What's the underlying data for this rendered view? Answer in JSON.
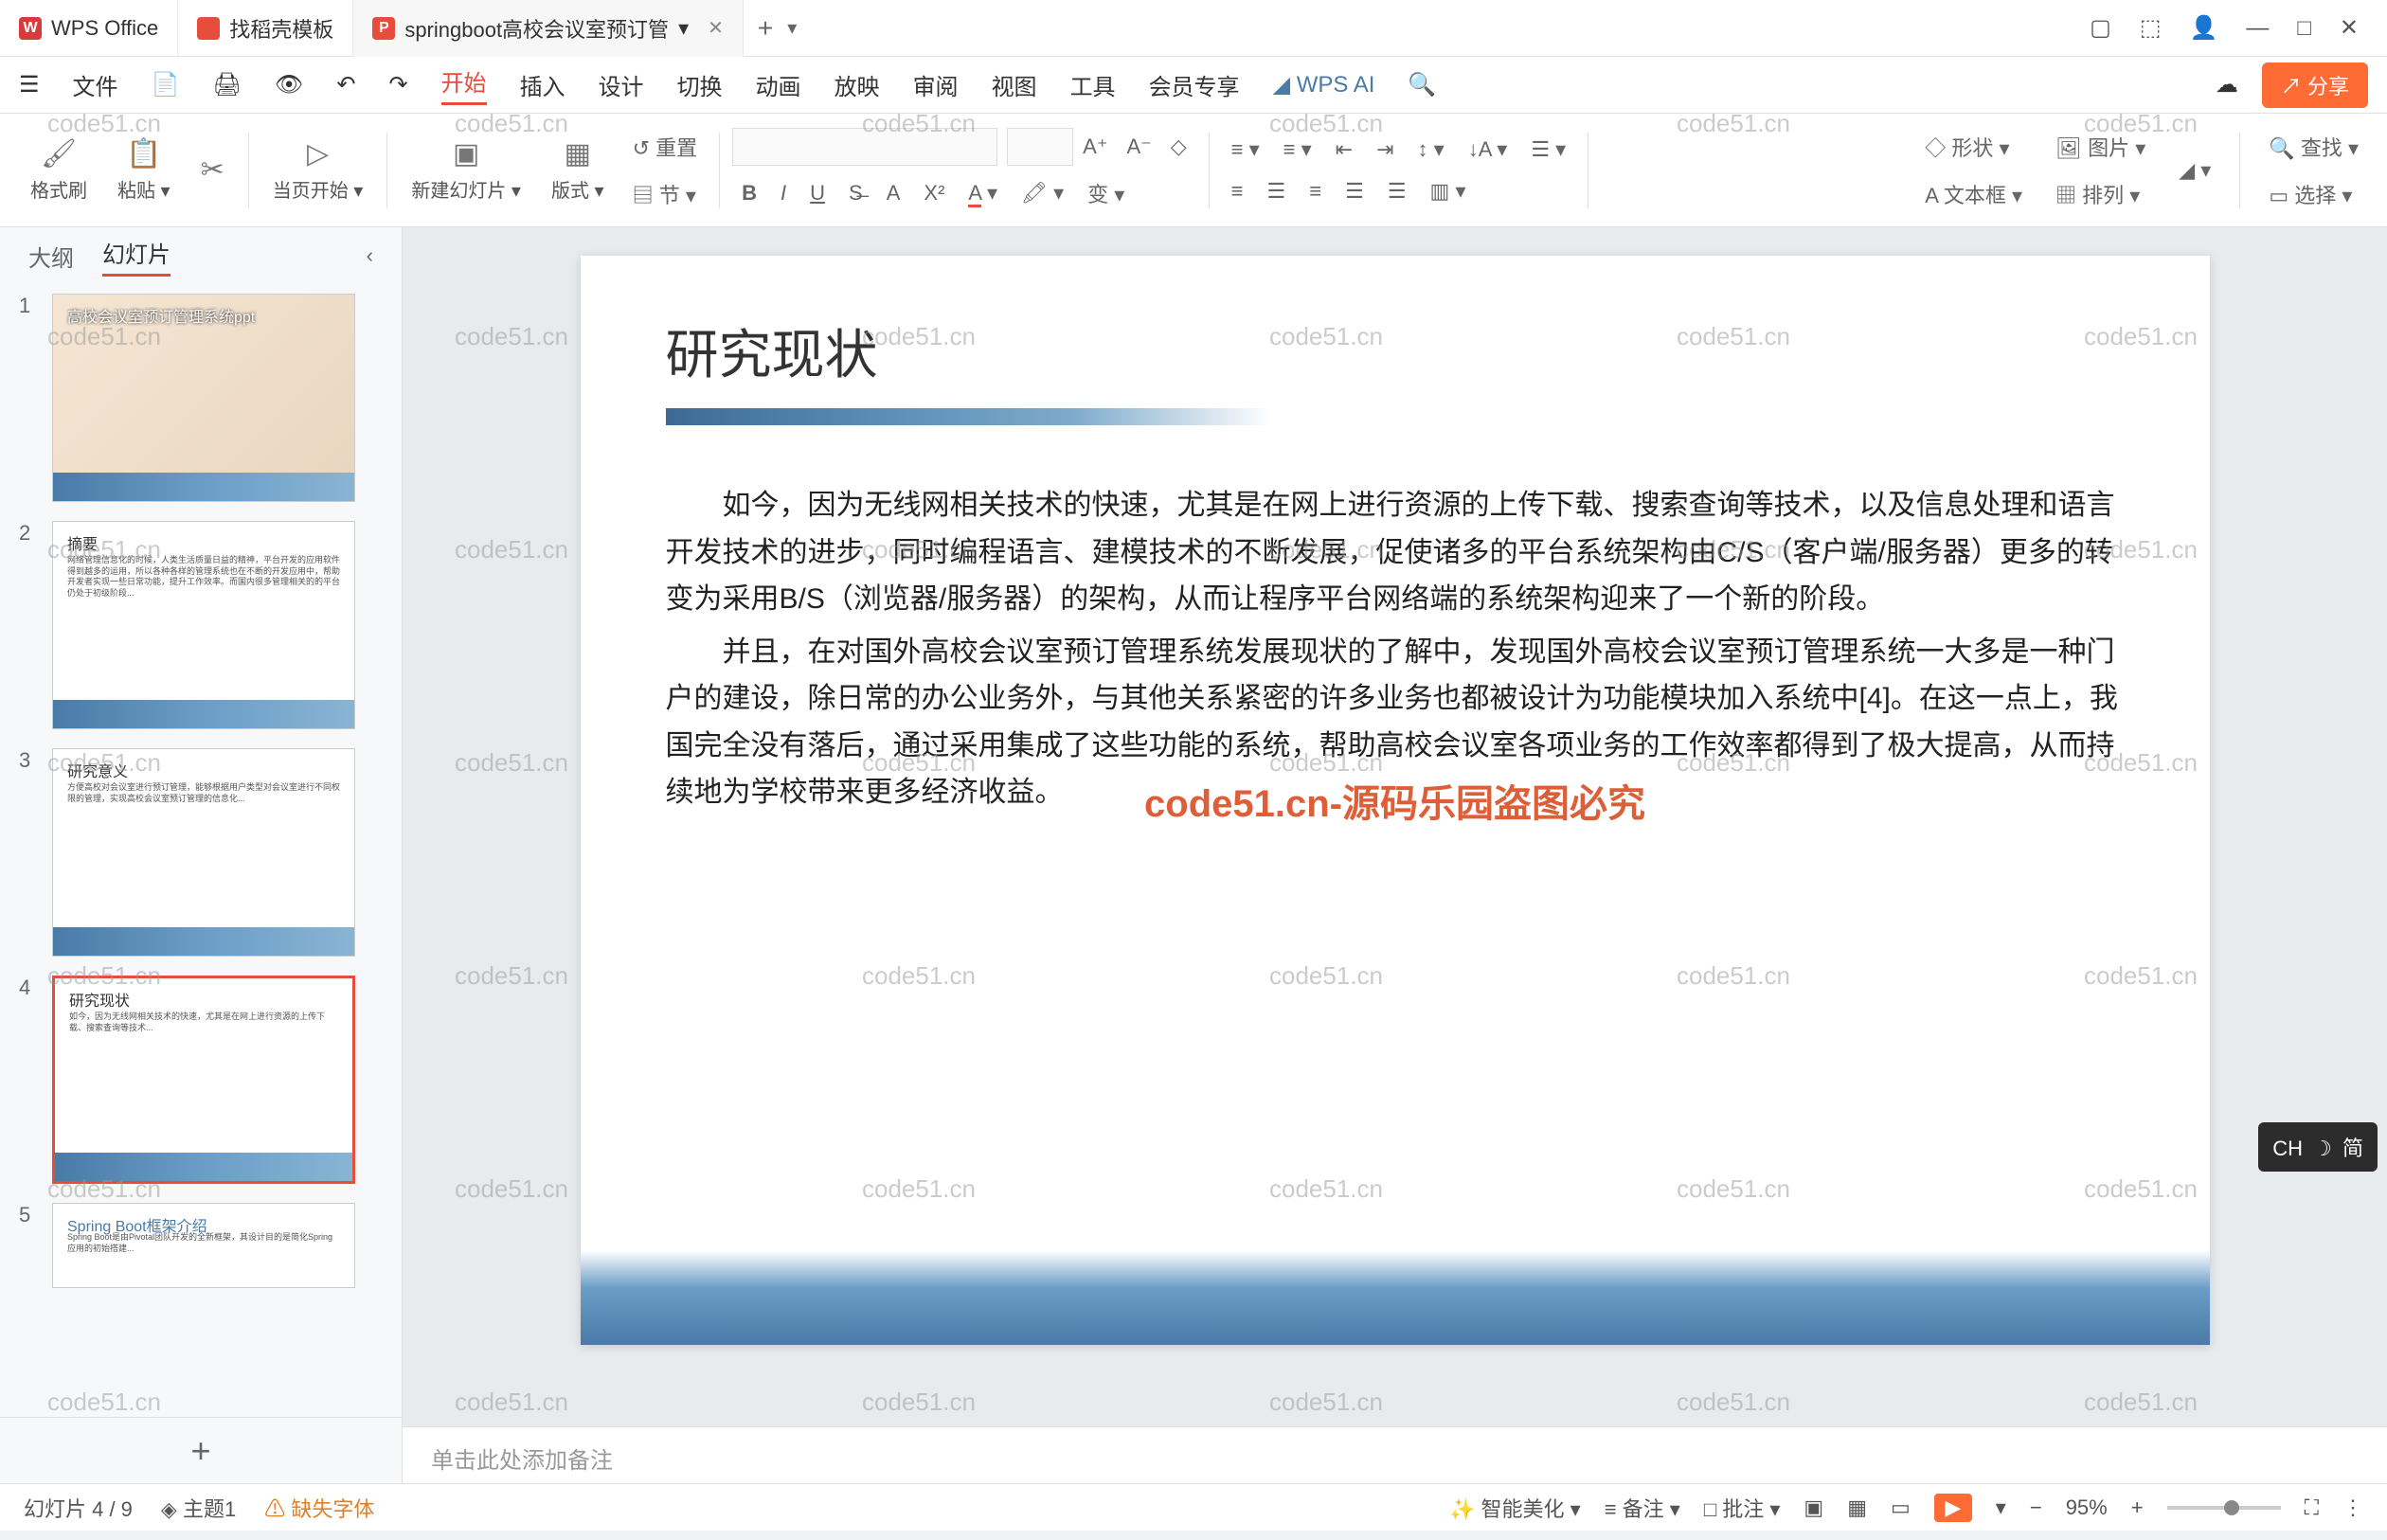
{
  "titlebar": {
    "tabs": [
      {
        "icon": "W",
        "label": "WPS Office"
      },
      {
        "icon": "D",
        "label": "找稻壳模板"
      },
      {
        "icon": "P",
        "label": "springboot高校会议室预订管",
        "active": true
      }
    ],
    "win": {
      "box": "▢",
      "cube": "⬚",
      "avatar": "👤",
      "min": "—",
      "max": "□",
      "close": "✕"
    }
  },
  "menubar": {
    "file": "文件",
    "items": [
      "开始",
      "插入",
      "设计",
      "切换",
      "动画",
      "放映",
      "审阅",
      "视图",
      "工具",
      "会员专享",
      "WPS AI"
    ],
    "active": "开始",
    "share": "分享"
  },
  "ribbon": {
    "groups": {
      "格式刷": "格式刷",
      "粘贴": "粘贴",
      "当页开始": "当页开始",
      "新建幻灯片": "新建幻灯片",
      "版式": "版式",
      "节": "节",
      "重置": "重置",
      "形状": "形状",
      "图片": "图片",
      "文本框": "文本框",
      "排列": "排列",
      "查找": "查找",
      "选择": "选择"
    }
  },
  "sidepanel": {
    "tabs": {
      "outline": "大纲",
      "slides": "幻灯片"
    },
    "thumbs": [
      {
        "n": "1",
        "title": "高校会议室预订管理系统ppt",
        "type": "cover"
      },
      {
        "n": "2",
        "title": "摘要",
        "type": "text"
      },
      {
        "n": "3",
        "title": "研究意义",
        "type": "text"
      },
      {
        "n": "4",
        "title": "研究现状",
        "type": "text",
        "sel": true
      },
      {
        "n": "5",
        "title": "Spring Boot框架介绍",
        "type": "text"
      }
    ]
  },
  "slide": {
    "title": "研究现状",
    "p1": "如今，因为无线网相关技术的快速，尤其是在网上进行资源的上传下载、搜索查询等技术，以及信息处理和语言开发技术的进步，同时编程语言、建模技术的不断发展，促使诸多的平台系统架构由C/S（客户端/服务器）更多的转变为采用B/S（浏览器/服务器）的架构，从而让程序平台网络端的系统架构迎来了一个新的阶段。",
    "p2": "并且，在对国外高校会议室预订管理系统发展现状的了解中，发现国外高校会议室预订管理系统一大多是一种门户的建设，除日常的办公业务外，与其他关系紧密的许多业务也都被设计为功能模块加入系统中[4]。在这一点上，我国完全没有落后，通过采用集成了这些功能的系统，帮助高校会议室各项业务的工作效率都得到了极大提高，从而持续地为学校带来更多经济收益。",
    "watermark": "code51.cn-源码乐园盗图必究"
  },
  "notes": {
    "placeholder": "单击此处添加备注"
  },
  "statusbar": {
    "slide": "幻灯片 4 / 9",
    "theme": "主题1",
    "missing": "缺失字体",
    "smart": "智能美化",
    "notes": "备注",
    "comment": "批注",
    "zoom": "95%"
  },
  "ime": {
    "lang": "CH",
    "mode": "简"
  },
  "wm": "code51.cn"
}
